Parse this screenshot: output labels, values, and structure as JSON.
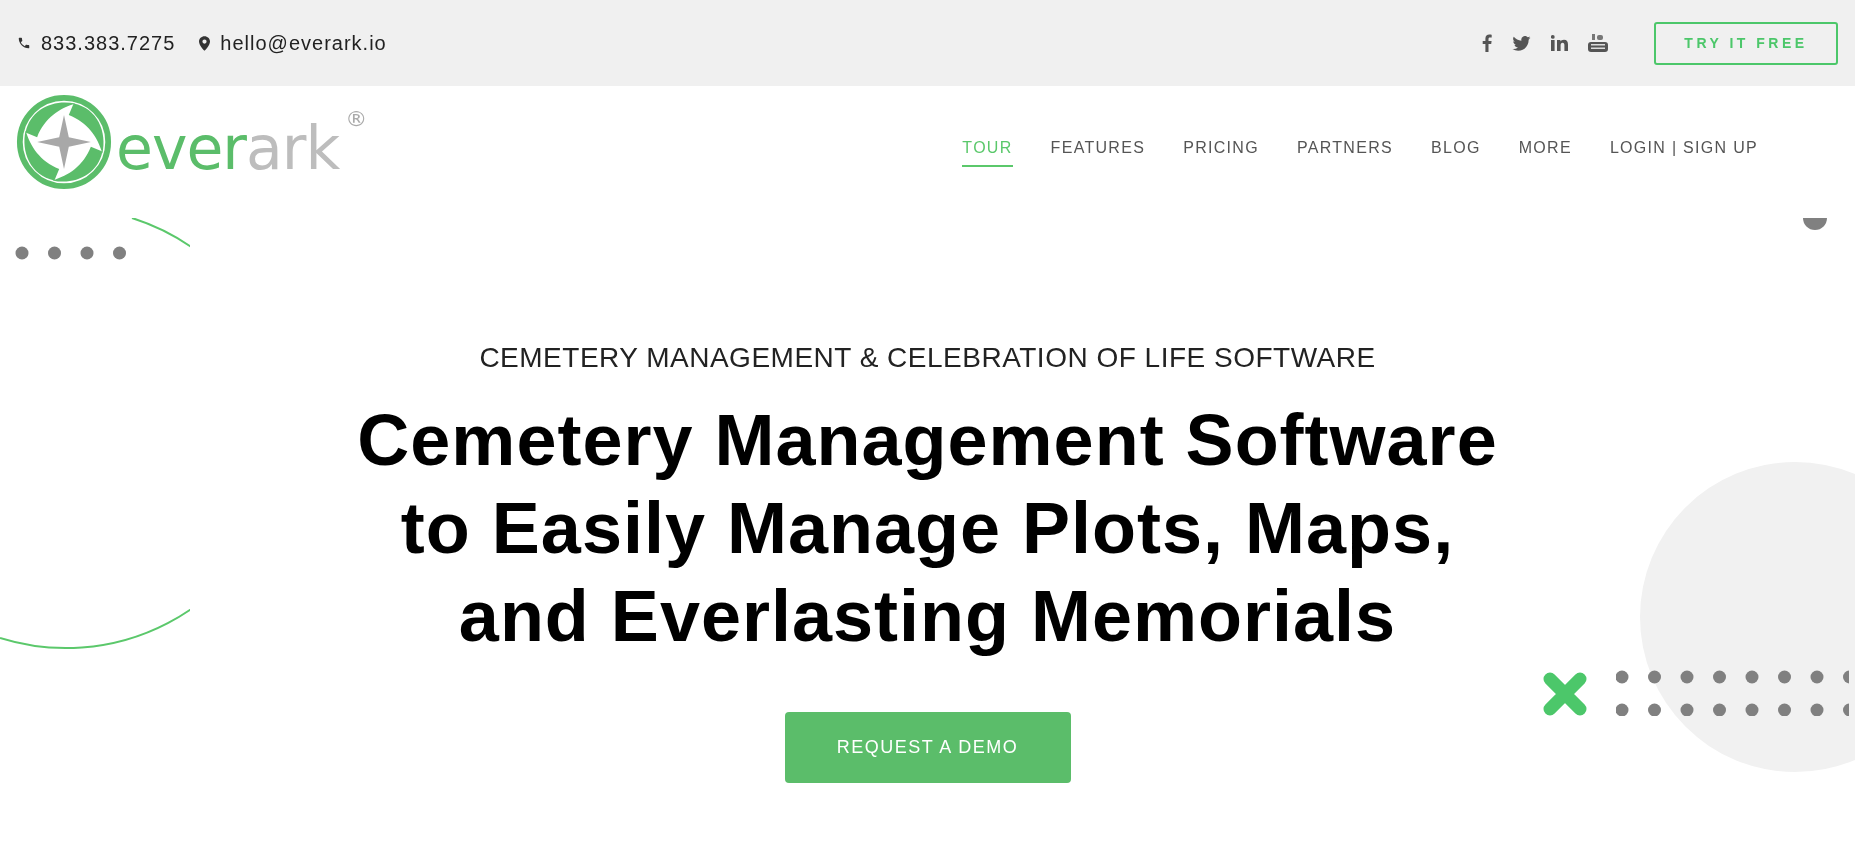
{
  "top_bar": {
    "phone": "833.383.7275",
    "email": "hello@everark.io",
    "try_button": "TRY IT FREE"
  },
  "logo": {
    "green_part": "ever",
    "grey_part": "ark",
    "mark": "®"
  },
  "nav": [
    {
      "label": "TOUR",
      "selected": true
    },
    {
      "label": "FEATURES",
      "selected": false
    },
    {
      "label": "PRICING",
      "selected": false
    },
    {
      "label": "PARTNERS",
      "selected": false
    },
    {
      "label": "BLOG",
      "selected": false
    },
    {
      "label": "MORE",
      "selected": false
    },
    {
      "label": "LOGIN | SIGN UP",
      "selected": false
    }
  ],
  "hero": {
    "tagline": "CEMETERY MANAGEMENT & CELEBRATION OF LIFE SOFTWARE",
    "headline_lines": [
      "Cemetery Management Software",
      "to Easily Manage Plots, Maps,",
      "and Everlasting Memorials"
    ],
    "cta": "REQUEST A DEMO"
  }
}
